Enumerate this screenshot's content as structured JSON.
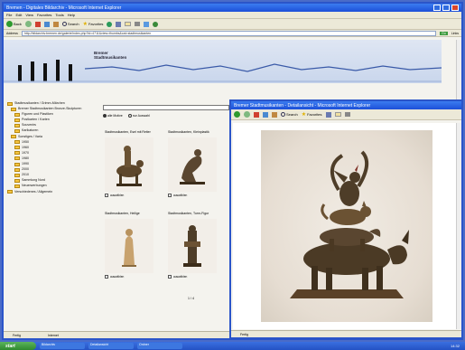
{
  "browser": {
    "title": "Bremen - Digitales Bildarchiv - Microsoft Internet Explorer",
    "menu": [
      "File",
      "Edit",
      "View",
      "Favorites",
      "Tools",
      "Help"
    ],
    "toolbar": {
      "back": "Back",
      "search": "Search",
      "favorites": "Favorites"
    },
    "address_label": "Address",
    "address": "http://bildarchiv.bremen.de/galerie/index.php?id=4711&view=thumbs&cat=stadtmusikanten",
    "go": "Go",
    "links": "Links"
  },
  "site": {
    "logo_line1": "Bremer",
    "logo_line2": "Stadtmusikanten"
  },
  "tree": [
    "Stadtmusikanten / Grimm-Märchen",
    "Bremer Stadtmusikanten Bronze-Skulpturen",
    "Figuren und Plastiken",
    "Postkarten / Karten",
    "Souvenirs",
    "Karikaturen",
    "Sonstiges / Varia",
    "1950",
    "1960",
    "1970",
    "1980",
    "1990",
    "2000",
    "2010",
    "Sammlung Nord",
    "Neuerwerbungen",
    "Verschiedenes / Allgemein"
  ],
  "search": {
    "placeholder": "",
    "option_all": "alle Motive",
    "option_sel": "nur Auswahl"
  },
  "cards": [
    {
      "title": "Stadtmusikanten, Esel mit Reiter",
      "check": "auswählen"
    },
    {
      "title": "Stadtmusikanten, Kleinplastik",
      "check": "auswählen"
    },
    {
      "title": "Stadtmusikanten, Heilige",
      "check": "auswählen"
    },
    {
      "title": "Stadtmusikanten, Turm-Figur",
      "check": "auswählen"
    }
  ],
  "pager": "1 / 4",
  "status": {
    "zone": "Internet",
    "done": "Fertig"
  },
  "popup": {
    "title": "Bremer Stadtmusikanten - Detailansicht - Microsoft Internet Explorer",
    "status": "Fertig"
  },
  "taskbar": {
    "start": "start",
    "tasks": [
      "Bildarchiv",
      "Detailansicht",
      "Ordner"
    ],
    "clock": "14:32"
  },
  "colors": {
    "bronze": "#6b5233",
    "xp_blue": "#2452c4"
  }
}
